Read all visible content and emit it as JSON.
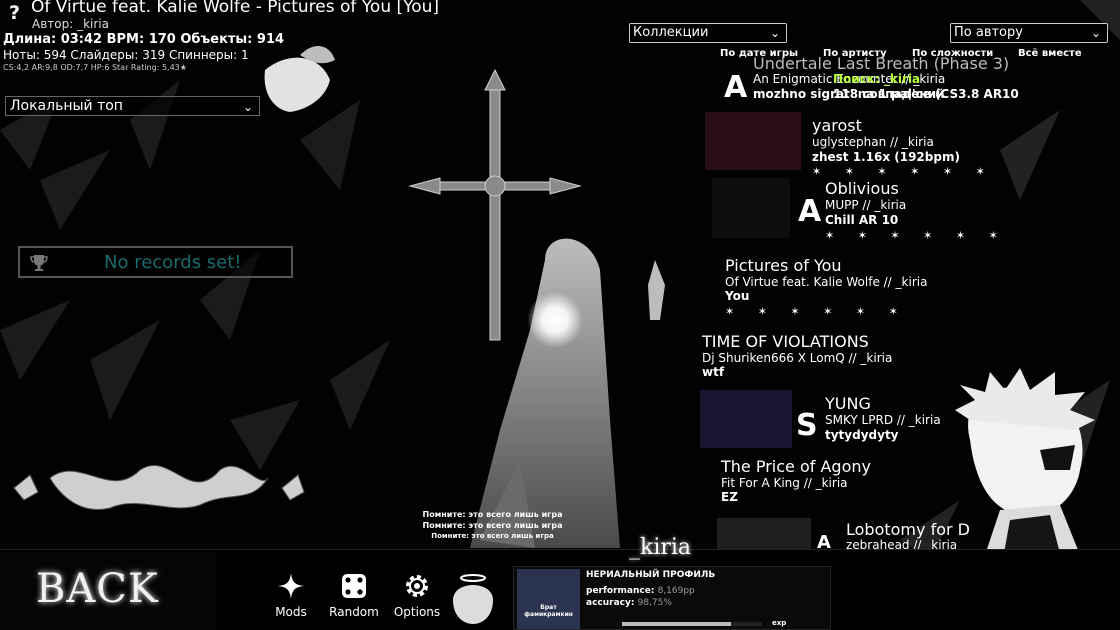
{
  "song": {
    "title": "Of Virtue feat. Kalie Wolfe - Pictures of You [You]",
    "author": "Автор: _kiria",
    "stats_line1": "Длина: 03:42 BPM: 170 Объекты: 914",
    "stats_line2": "Ноты: 594 Слайдеры: 319 Спиннеры: 1",
    "stats_line3": "CS:4,2 AR:9,8 OD:7,7 HP:6 Star Rating: 5,43★"
  },
  "leaderboard": {
    "dropdown_value": "Локальный топ",
    "empty_text": "No records set!"
  },
  "filters": {
    "collections": "Коллекции",
    "sort": "По автору",
    "tabs": [
      "По дате игры",
      "По артисту",
      "По сложности",
      "Всё вместе"
    ]
  },
  "search": {
    "label": "Поиск: _kiria",
    "count": "118 совпадений"
  },
  "songs": [
    {
      "title": "Undertale Last Breath (Phase 3)",
      "artist": "An Enigmatic Encounter // _kiria",
      "diff": "mozhno sigrat' na 1 pal'ce (CS3.8 AR10",
      "grade": "A"
    },
    {
      "title": "yarost",
      "artist": "uglystephan // _kiria",
      "diff": "zhest 1.16x (192bpm)",
      "grade": ""
    },
    {
      "title": "Oblivious",
      "artist": "MUPP // _kiria",
      "diff": "Chill AR 10",
      "grade": "A"
    },
    {
      "title": "Pictures of You",
      "artist": "Of Virtue feat. Kalie Wolfe // _kiria",
      "diff": "You",
      "grade": ""
    },
    {
      "title": "TIME OF VIOLATIONS",
      "artist": "Dj Shuriken666 X LomQ // _kiria",
      "diff": "wtf",
      "grade": ""
    },
    {
      "title": "YUNG",
      "artist": "SMKY LPRD // _kiria",
      "diff": "tytydydyty",
      "grade": "S"
    },
    {
      "title": "The Price of Agony",
      "artist": "Fit For A King // _kiria",
      "diff": "EZ",
      "grade": ""
    },
    {
      "title": "Lobotomy for D",
      "artist": "zebrahead // _kiria",
      "diff": "",
      "grade": "A"
    }
  ],
  "stars_row": "✶ ✶ ✶ ✶ ✶ ✶",
  "reminders": [
    "Помните: это всего лишь игра",
    "Помните: это всего лишь игра",
    "Помните: это всего лишь игра"
  ],
  "toolbar": {
    "back": "BACK",
    "mods": "Mods",
    "random": "Random",
    "options": "Options"
  },
  "profile": {
    "username": "_kiria",
    "name_line": "НЕРИАЛЬНЫЙ ПРОФИЛЬ",
    "performance_label": "performance:",
    "performance_value": "8,169pp",
    "accuracy_label": "accuracy:",
    "accuracy_value": "98,75%",
    "avatar_caption": "Брат фамикрамкин",
    "exp_label": "exp",
    "exp_fraction": 0.78
  },
  "colors": {
    "search_accent": "#b7ff3a",
    "no_records_text": "#1c6a6a"
  }
}
